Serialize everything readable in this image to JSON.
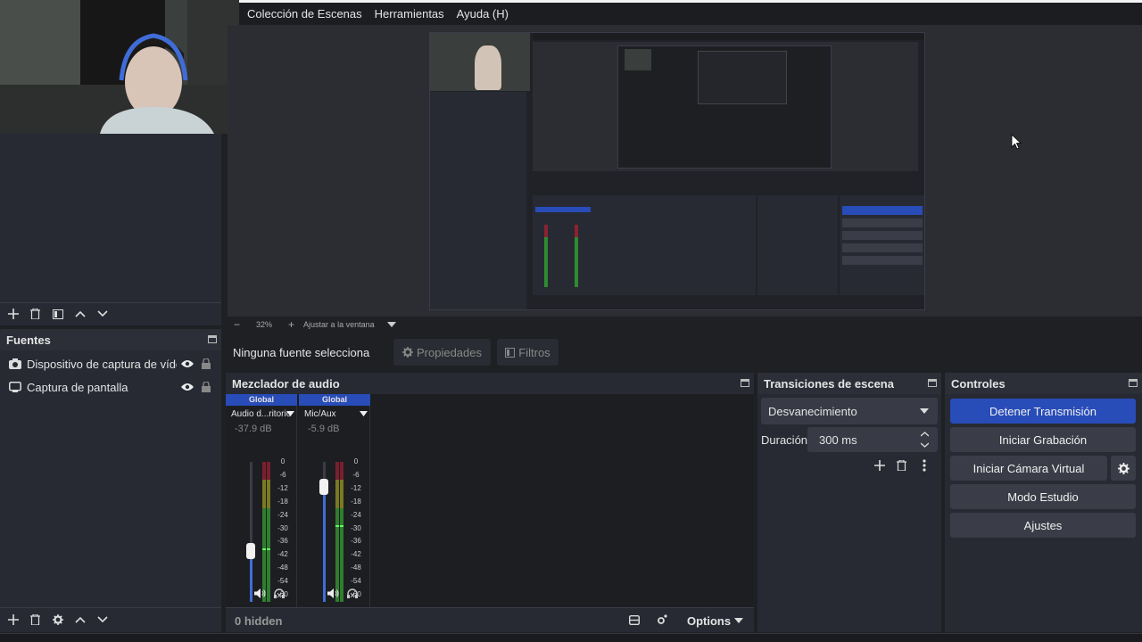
{
  "menu": [
    "Colección de Escenas",
    "Herramientas",
    "Ayuda (H)"
  ],
  "preview": {
    "zoom_minus": "−",
    "zoom_level": "32%",
    "zoom_plus": "+",
    "fit_label": "Ajustar a la ventana"
  },
  "context_bar": {
    "no_source": "Ninguna fuente selecciona",
    "properties": "Propiedades",
    "filters": "Filtros"
  },
  "sources": {
    "title": "Fuentes",
    "items": [
      {
        "label": "Dispositivo de captura de vídeo",
        "icon": "camera-icon"
      },
      {
        "label": "Captura de pantalla",
        "icon": "monitor-icon"
      }
    ]
  },
  "mixer": {
    "title": "Mezclador de audio",
    "channels": [
      {
        "tag": "Global",
        "name": "Audio d...ritorio",
        "db": "-37.9 dB",
        "fader": 0.36,
        "level": 0.38
      },
      {
        "tag": "Global",
        "name": "Mic/Aux",
        "db": "-5.9 dB",
        "fader": 0.82,
        "level": 0.55
      }
    ],
    "ticks": [
      "0",
      "-6",
      "-12",
      "-18",
      "-24",
      "-30",
      "-36",
      "-42",
      "-48",
      "-54",
      "-60"
    ],
    "hidden": "0 hidden",
    "options": "Options"
  },
  "transitions": {
    "title": "Transiciones de escena",
    "selected": "Desvanecimiento",
    "duration_label": "Duración",
    "duration_value": "300 ms"
  },
  "controls": {
    "title": "Controles",
    "stop_stream": "Detener Transmisión",
    "start_record": "Iniciar Grabación",
    "virtual_cam": "Iniciar Cámara Virtual",
    "studio_mode": "Modo Estudio",
    "settings": "Ajustes"
  },
  "colors": {
    "accent": "#284cb8",
    "panel": "#272a33",
    "bg": "#1f2024"
  }
}
